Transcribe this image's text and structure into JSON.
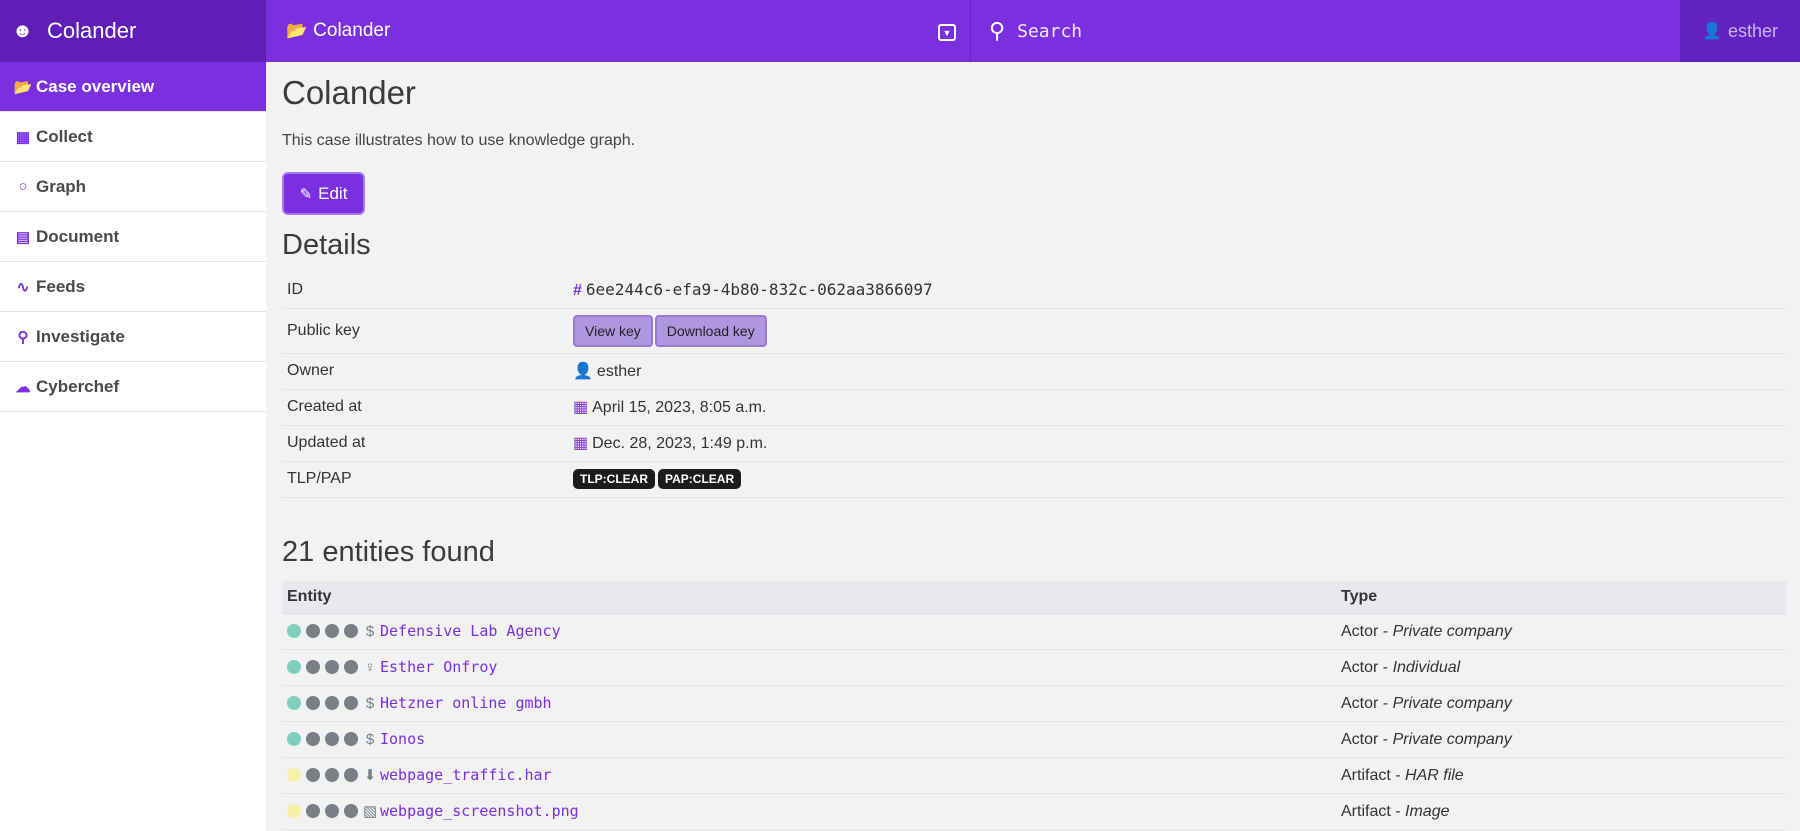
{
  "app": {
    "name": "Colander"
  },
  "topbar": {
    "case_name": "Colander",
    "search_placeholder": "Search",
    "user": "esther"
  },
  "sidebar": {
    "items": [
      {
        "label": "Case overview",
        "icon": "folder-open-icon",
        "active": true
      },
      {
        "label": "Collect",
        "icon": "grid-icon"
      },
      {
        "label": "Graph",
        "icon": "graph-icon"
      },
      {
        "label": "Document",
        "icon": "document-icon"
      },
      {
        "label": "Feeds",
        "icon": "rss-icon"
      },
      {
        "label": "Investigate",
        "icon": "search-icon"
      },
      {
        "label": "Cyberchef",
        "icon": "chef-hat-icon"
      }
    ]
  },
  "case": {
    "title": "Colander",
    "description": "This case illustrates how to use knowledge graph.",
    "edit_label": "Edit"
  },
  "details": {
    "heading": "Details",
    "id_label": "ID",
    "id_value": "6ee244c6-efa9-4b80-832c-062aa3866097",
    "public_key_label": "Public key",
    "view_key_label": "View key",
    "download_key_label": "Download key",
    "owner_label": "Owner",
    "owner_value": "esther",
    "created_label": "Created at",
    "created_value": "April 15, 2023, 8:05 a.m.",
    "updated_label": "Updated at",
    "updated_value": "Dec. 28, 2023, 1:49 p.m.",
    "tlp_label": "TLP/PAP",
    "tlp_value": "TLP:CLEAR",
    "pap_value": "PAP:CLEAR"
  },
  "entities": {
    "heading": "21 entities found",
    "columns": [
      "Entity",
      "Type"
    ],
    "rows": [
      {
        "name": "Defensive Lab Agency",
        "icon": "dollar-icon",
        "type": "Actor",
        "subtype": "Private company",
        "first_dot_color": "#7fcfbd"
      },
      {
        "name": "Esther Onfroy",
        "icon": "person-icon",
        "type": "Actor",
        "subtype": "Individual",
        "first_dot_color": "#7fcfbd"
      },
      {
        "name": "Hetzner online gmbh",
        "icon": "dollar-icon",
        "type": "Actor",
        "subtype": "Private company",
        "first_dot_color": "#7fcfbd"
      },
      {
        "name": "Ionos",
        "icon": "dollar-icon",
        "type": "Actor",
        "subtype": "Private company",
        "first_dot_color": "#7fcfbd"
      },
      {
        "name": "webpage_traffic.har",
        "icon": "file-download-icon",
        "type": "Artifact",
        "subtype": "HAR file",
        "first_dot_color": "#f5f1a8"
      },
      {
        "name": "webpage_screenshot.png",
        "icon": "image-icon",
        "type": "Artifact",
        "subtype": "Image",
        "first_dot_color": "#f5f1a8"
      }
    ]
  },
  "colors": {
    "accent": "#7b30df",
    "brand_dark": "#5f1fb7"
  }
}
